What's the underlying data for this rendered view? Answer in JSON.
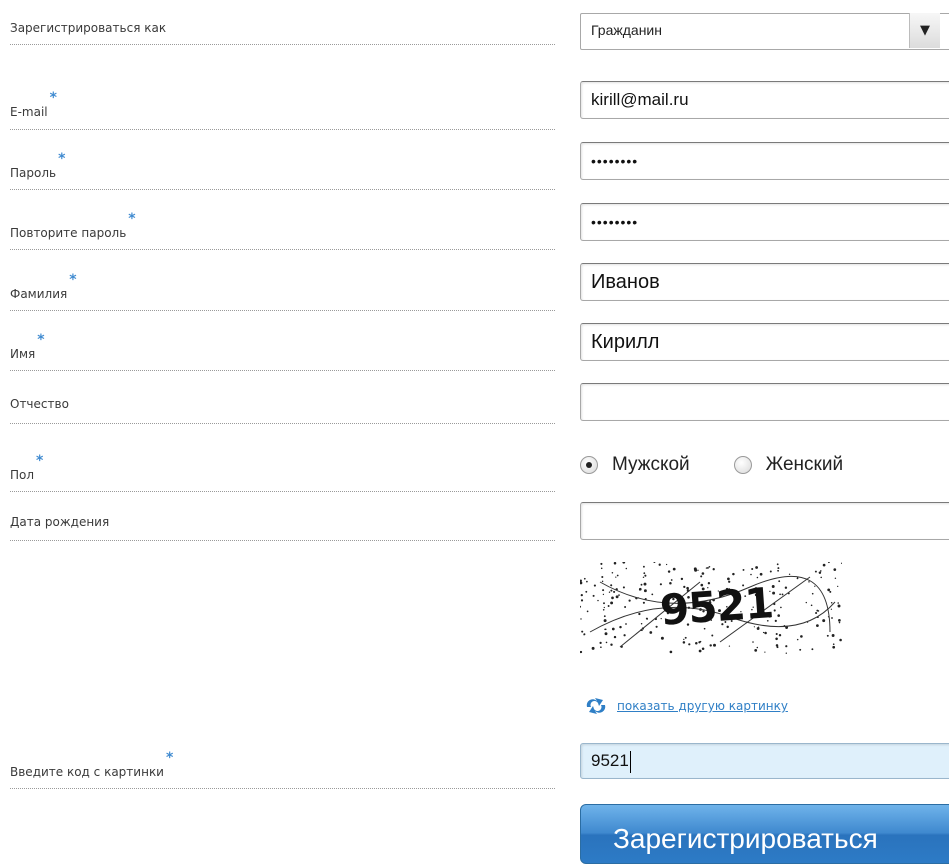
{
  "form": {
    "register_as": {
      "label": "Зарегистрироваться как",
      "value": "Гражданин"
    },
    "email": {
      "label": "E-mail",
      "required": "*",
      "value": "kirill@mail.ru"
    },
    "password": {
      "label": "Пароль",
      "required": "*",
      "value": "••••••••"
    },
    "password_repeat": {
      "label": "Повторите пароль",
      "required": "*",
      "value": "••••••••"
    },
    "last_name": {
      "label": "Фамилия",
      "required": "*",
      "value": "Иванов"
    },
    "first_name": {
      "label": "Имя",
      "required": "*",
      "value": "Кирилл"
    },
    "middle_name": {
      "label": "Отчество",
      "value": ""
    },
    "gender": {
      "label": "Пол",
      "required": "*",
      "options": [
        "Мужской",
        "Женский"
      ],
      "selected": "Мужской"
    },
    "birth_date": {
      "label": "Дата рождения",
      "value": ""
    },
    "captcha": {
      "code_image": "9521",
      "reload_link": "показать другую картинку"
    },
    "captcha_input": {
      "label": "Введите код с картинки",
      "required": "*",
      "value": "9521"
    },
    "submit_label": "Зарегистрироваться"
  },
  "icons": {
    "reload": "reload-icon",
    "dropdown": "triangle-down-icon"
  },
  "colors": {
    "required_star": "#3f8ad0",
    "link": "#2f7fc6",
    "button": "#3f89cf",
    "captcha_input_bg": "#dff0fb"
  }
}
